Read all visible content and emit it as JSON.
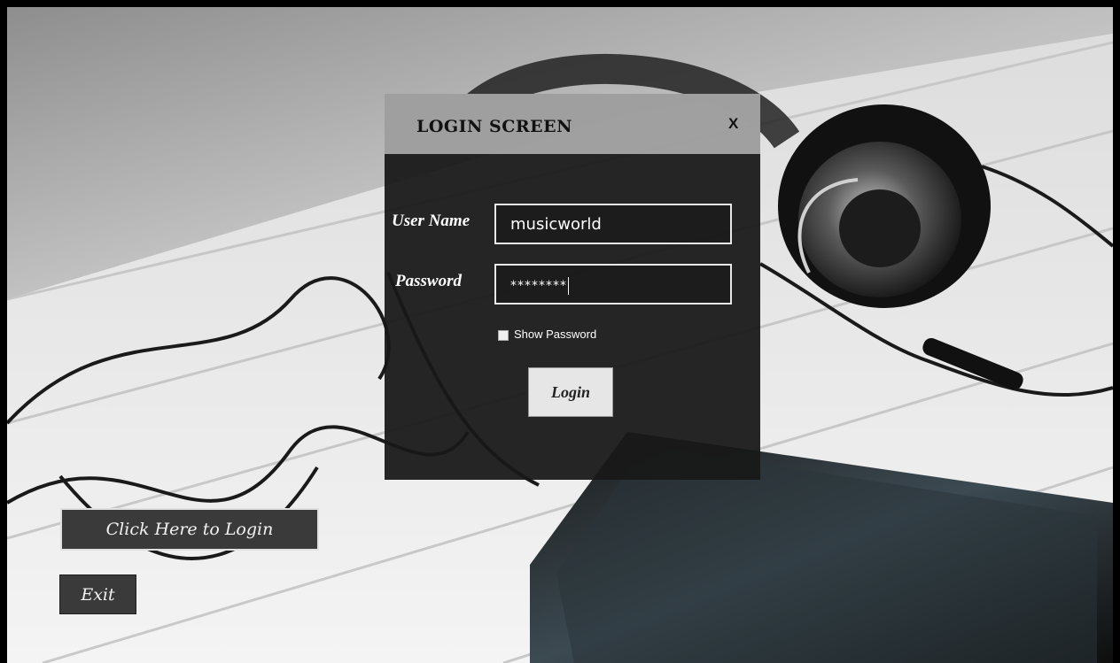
{
  "dialog": {
    "title": "LOGIN SCREEN",
    "close_label": "X",
    "user_label": "User Name",
    "password_label": "Password",
    "username_value": "musicworld",
    "password_value": "********",
    "show_password_label": "Show Password",
    "show_password_checked": false,
    "login_label": "Login"
  },
  "actions": {
    "click_here_label": "Click Here to Login",
    "exit_label": "Exit"
  },
  "colors": {
    "dialog_bg": "#181818",
    "header_bg": "#aaaaaa",
    "button_dark": "#3a3a3a"
  }
}
